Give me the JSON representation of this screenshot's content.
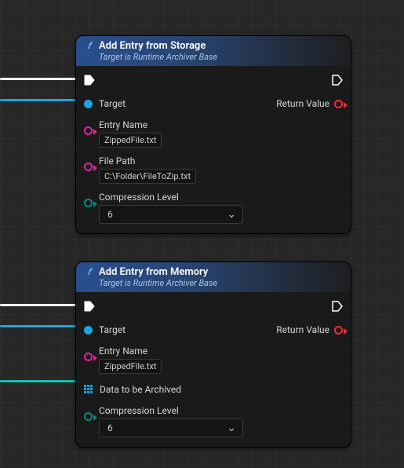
{
  "nodes": {
    "storage": {
      "title": "Add Entry from Storage",
      "subtitle": "Target is Runtime Archiver Base",
      "pins": {
        "target_label": "Target",
        "return_label": "Return Value",
        "entry_name_label": "Entry Name",
        "entry_name_value": "ZippedFile.txt",
        "file_path_label": "File Path",
        "file_path_value": "C:\\Folder\\FileToZip.txt",
        "compression_label": "Compression Level",
        "compression_value": "6"
      }
    },
    "memory": {
      "title": "Add Entry from Memory",
      "subtitle": "Target is Runtime Archiver Base",
      "pins": {
        "target_label": "Target",
        "return_label": "Return Value",
        "entry_name_label": "Entry Name",
        "entry_name_value": "ZippedFile.txt",
        "data_label": "Data to be Archived",
        "compression_label": "Compression Level",
        "compression_value": "6"
      }
    }
  }
}
